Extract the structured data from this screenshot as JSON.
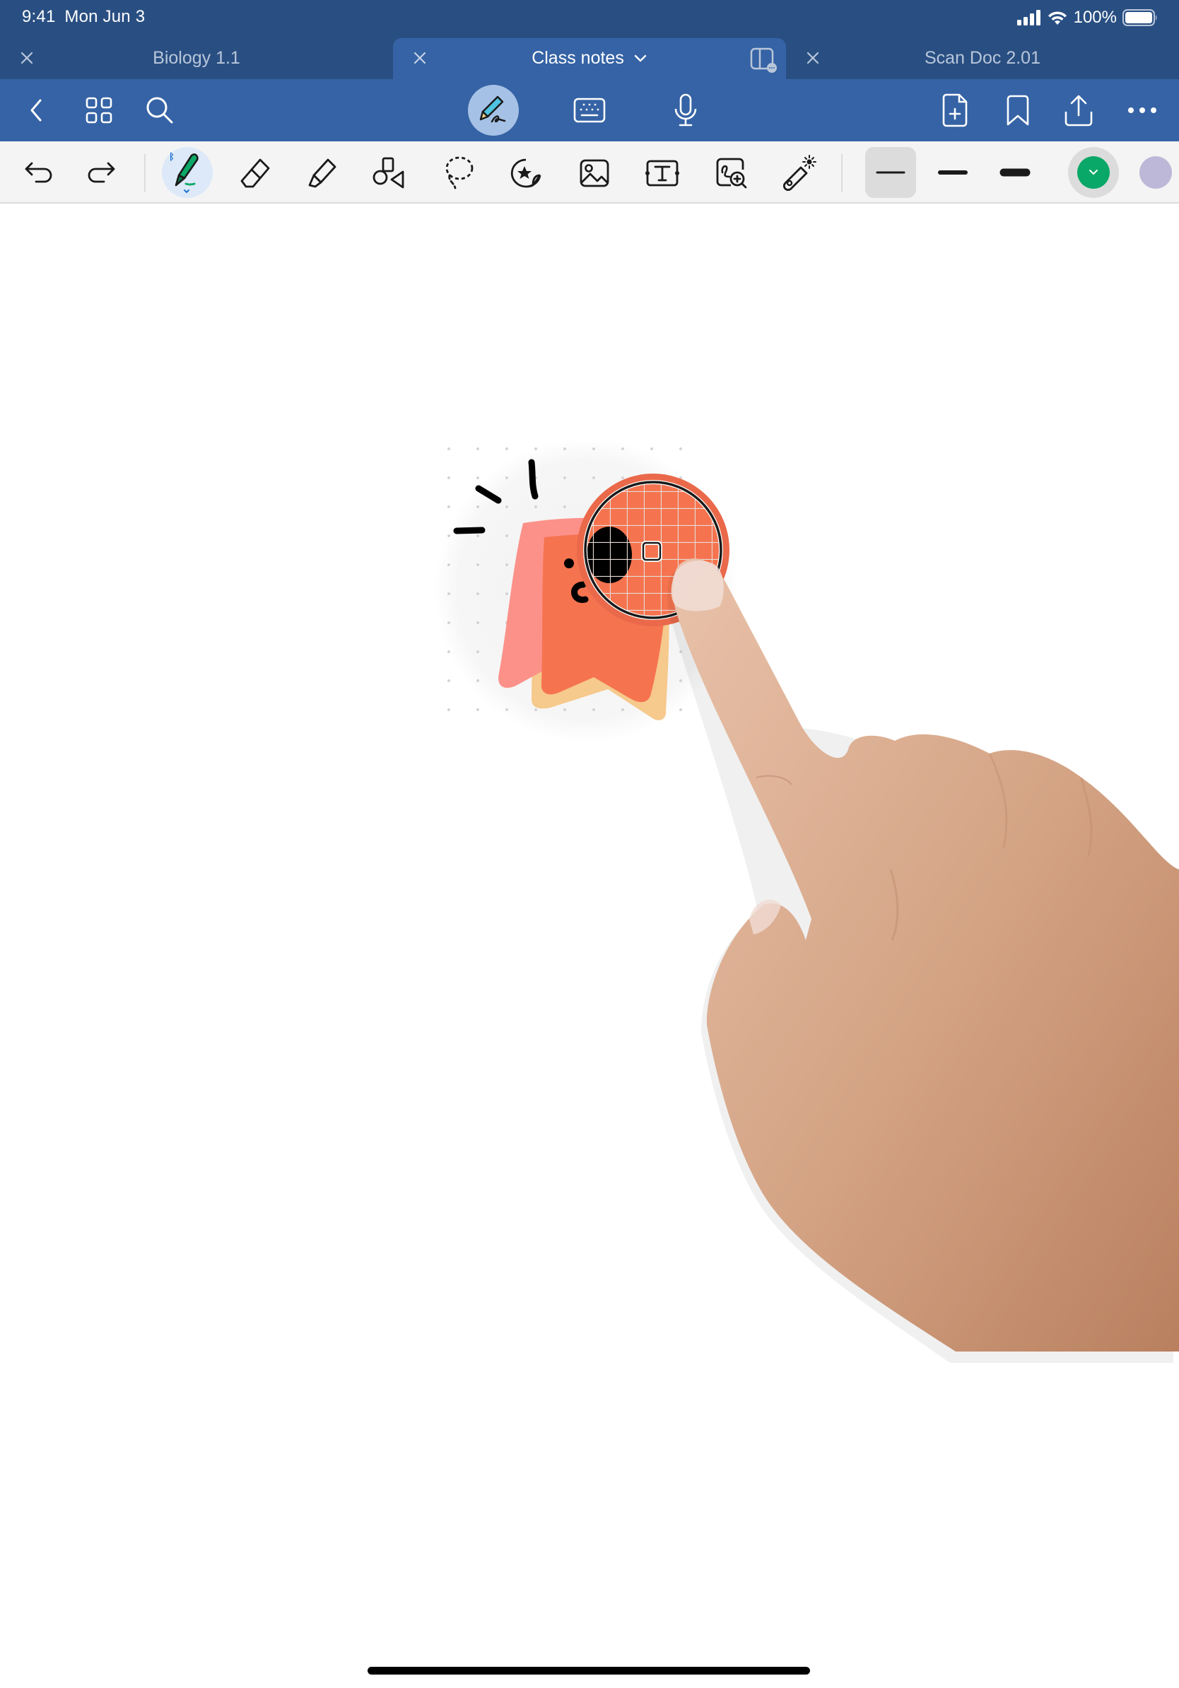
{
  "status_bar": {
    "time": "9:41",
    "date": "Mon Jun 3",
    "battery": "100%",
    "icons": [
      "cellular-signal-icon",
      "wifi-icon",
      "battery-icon"
    ]
  },
  "tabs": [
    {
      "label": "Biology 1.1",
      "active": false
    },
    {
      "label": "Class notes",
      "active": true,
      "has_dropdown": true
    },
    {
      "label": "Scan Doc 2.01",
      "active": false
    }
  ],
  "nav_bar": {
    "left": [
      "back-icon",
      "grid-view-icon",
      "search-icon"
    ],
    "modes": [
      {
        "name": "handwriting-mode",
        "active": true
      },
      {
        "name": "keyboard-mode",
        "active": false
      },
      {
        "name": "voice-mode",
        "active": false
      }
    ],
    "right": [
      "add-page-icon",
      "bookmark-icon",
      "share-icon",
      "more-icon"
    ]
  },
  "toolbar": {
    "tools": [
      {
        "name": "undo",
        "active": false
      },
      {
        "name": "redo",
        "active": false
      },
      {
        "name": "pen",
        "active": true,
        "badge": "bluetooth"
      },
      {
        "name": "eraser",
        "active": false
      },
      {
        "name": "highlighter",
        "active": false
      },
      {
        "name": "shapes",
        "active": false
      },
      {
        "name": "lasso",
        "active": false
      },
      {
        "name": "sticker",
        "active": false
      },
      {
        "name": "image",
        "active": false
      },
      {
        "name": "text",
        "active": false
      },
      {
        "name": "zoom-window",
        "active": false
      },
      {
        "name": "laser-pointer",
        "active": false
      }
    ],
    "stroke_widths": [
      {
        "name": "thin",
        "active": true
      },
      {
        "name": "medium",
        "active": false
      },
      {
        "name": "thick",
        "active": false
      }
    ],
    "colors": [
      {
        "name": "green",
        "hex": "#0aa868",
        "active": true
      },
      {
        "name": "lavender",
        "hex": "#bdb8d8",
        "active": false
      }
    ]
  },
  "colors": {
    "status_bg": "#294f82",
    "nav_bg": "#3563a5",
    "active_mode_bg": "#a6c1e6",
    "toolbar_bg": "#f4f4f4",
    "illustration_coral": "#f5744f",
    "illustration_pink": "#fc918a",
    "illustration_peach": "#f6c98c"
  }
}
